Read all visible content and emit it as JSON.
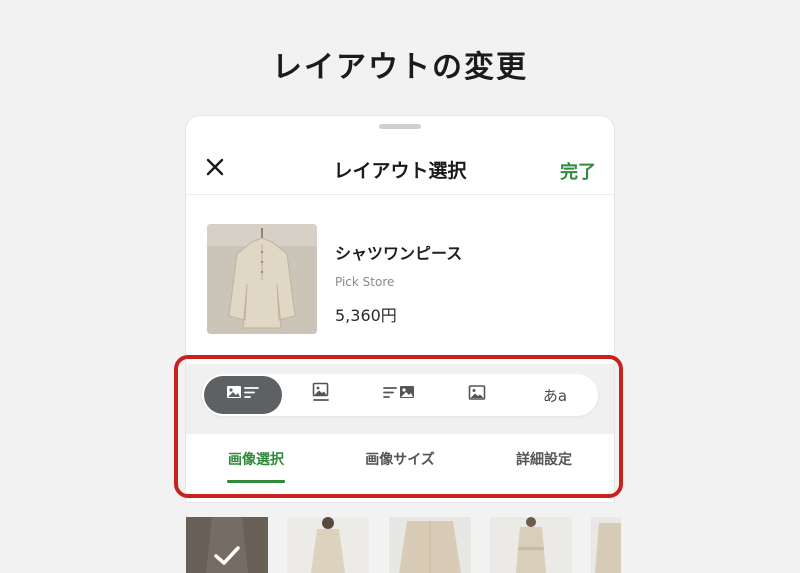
{
  "heading": "レイアウトの変更",
  "sheet": {
    "title": "レイアウト選択",
    "done_label": "完了"
  },
  "product": {
    "name": "シャツワンピース",
    "store": "Pick Store",
    "price": "5,360円"
  },
  "layout_options": [
    {
      "icon": "image-left-text-icon",
      "active": true
    },
    {
      "icon": "image-caption-icon",
      "active": false
    },
    {
      "icon": "text-left-image-icon",
      "active": false
    },
    {
      "icon": "image-only-icon",
      "active": false
    },
    {
      "label": "あa",
      "icon": "text-only-icon",
      "active": false
    }
  ],
  "tabs": [
    {
      "label": "画像選択",
      "active": true
    },
    {
      "label": "画像サイズ",
      "active": false
    },
    {
      "label": "詳細設定",
      "active": false
    }
  ],
  "colors": {
    "accent": "#2f8a3c",
    "highlight": "#c8221f",
    "active_chip": "#5e6164"
  },
  "images": {
    "selected_index": 0
  }
}
